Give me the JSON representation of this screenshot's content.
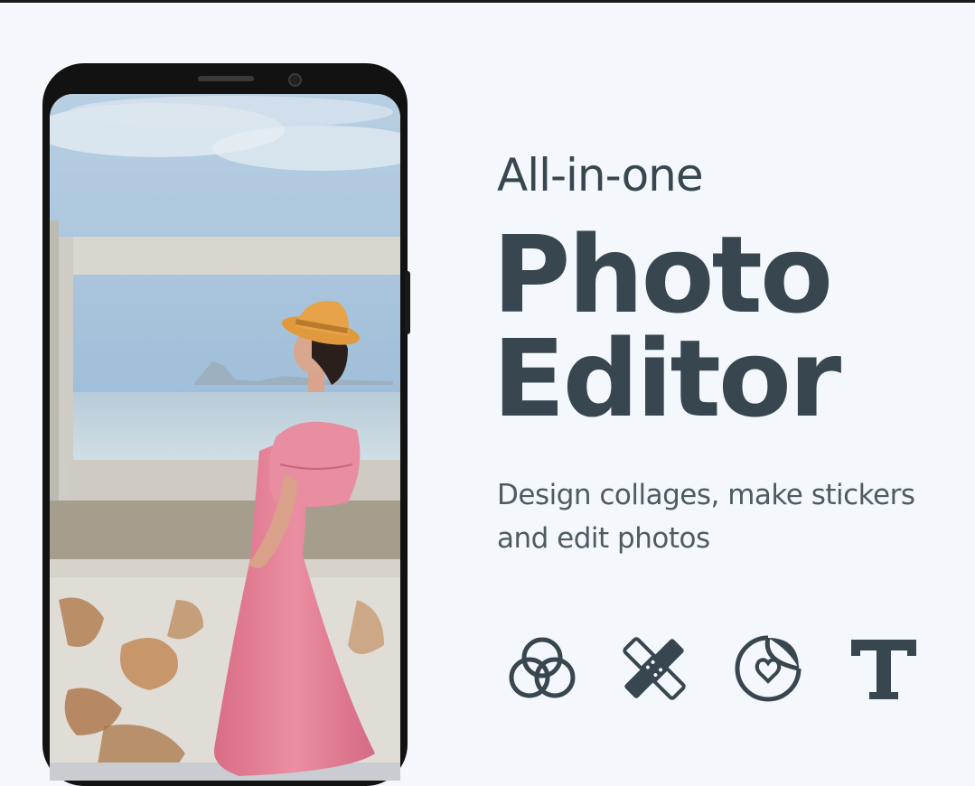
{
  "headline": {
    "tagline": "All-in-one",
    "title_line1": "Photo",
    "title_line2": "Editor",
    "subtitle_line1": "Design collages, make stickers",
    "subtitle_line2": "and edit photos"
  },
  "features": [
    {
      "icon": "overlapping-circles-icon"
    },
    {
      "icon": "bandage-heal-icon"
    },
    {
      "icon": "sticker-heart-icon"
    },
    {
      "icon": "text-t-icon"
    }
  ],
  "colors": {
    "background": "#f4f8fc",
    "text": "#38464f",
    "phone_frame": "#121212",
    "dress": "#e47f95",
    "hat": "#e39a3e"
  }
}
